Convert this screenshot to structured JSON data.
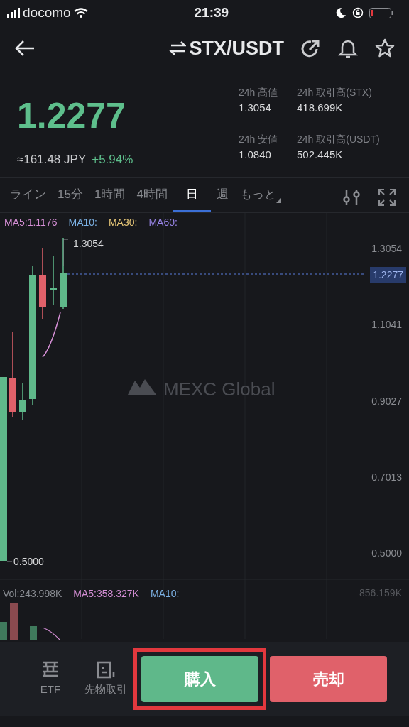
{
  "status_bar": {
    "carrier": "docomo",
    "time": "21:39"
  },
  "header": {
    "title": "STX/USDT"
  },
  "ticker": {
    "price": "1.2277",
    "approx": "≈161.48 JPY",
    "change": "+5.94%",
    "stats": [
      {
        "label": "24h 高値",
        "value": "1.3054"
      },
      {
        "label": "24h 取引高(STX)",
        "value": "418.699K"
      },
      {
        "label": "24h 安値",
        "value": "1.0840"
      },
      {
        "label": "24h 取引高(USDT)",
        "value": "502.445K"
      }
    ]
  },
  "timeframe_tabs": [
    {
      "label": "ライン",
      "selected": false,
      "kind": "text"
    },
    {
      "label": "15分",
      "selected": false,
      "kind": "text"
    },
    {
      "label": "1時間",
      "selected": false,
      "kind": "text"
    },
    {
      "label": "4時間",
      "selected": false,
      "kind": "text"
    },
    {
      "label": "日",
      "selected": true,
      "kind": "text"
    },
    {
      "label": "週",
      "selected": false,
      "kind": "text"
    },
    {
      "label": "もっと",
      "selected": false,
      "kind": "dropdown"
    }
  ],
  "chart": {
    "ma_legend": [
      {
        "label": "MA5:1.1176",
        "color": "#d68fd6"
      },
      {
        "label": "MA10:",
        "color": "#7cb1e4"
      },
      {
        "label": "MA30:",
        "color": "#e6c677"
      },
      {
        "label": "MA60:",
        "color": "#9a86ea"
      }
    ],
    "y_labels": [
      "1.3054",
      "1.1041",
      "0.9027",
      "0.7013",
      "0.5000"
    ],
    "current_price": "1.2277",
    "high_marker": "1.3054",
    "low_marker": "0.5000",
    "watermark": "MEXC Global"
  },
  "volume": {
    "legend": [
      {
        "label": "Vol:243.998K",
        "color": "#8a8d93"
      },
      {
        "label": "MA5:358.327K",
        "color": "#d68fd6"
      },
      {
        "label": "MA10:",
        "color": "#7cb1e4"
      }
    ],
    "max_label": "856.159K"
  },
  "bottom_nav": [
    {
      "label": "ETF",
      "kind": "etf"
    },
    {
      "label": "先物取引",
      "kind": "futures"
    }
  ],
  "actions": [
    {
      "label": "購入",
      "kind": "buy",
      "highlighted": true
    },
    {
      "label": "売却",
      "kind": "sell",
      "highlighted": false
    }
  ]
}
